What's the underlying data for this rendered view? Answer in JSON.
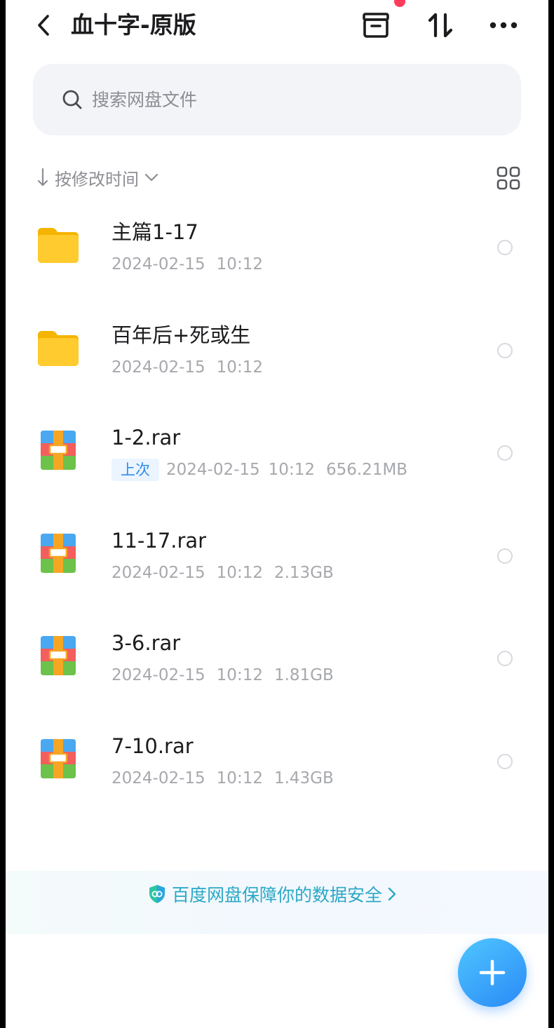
{
  "header": {
    "title": "血十字-原版",
    "icons": [
      "back-icon",
      "archive-icon",
      "transfer-icon",
      "more-icon"
    ]
  },
  "search": {
    "placeholder": "搜索网盘文件"
  },
  "sort": {
    "label": "按修改时间",
    "direction": "descending"
  },
  "files": [
    {
      "name": "主篇1-17",
      "type": "folder",
      "date": "2024-02-15",
      "time": "10:12",
      "size": "",
      "badge": ""
    },
    {
      "name": "百年后+死或生",
      "type": "folder",
      "date": "2024-02-15",
      "time": "10:12",
      "size": "",
      "badge": ""
    },
    {
      "name": "1-2.rar",
      "type": "archive",
      "date": "2024-02-15",
      "time": "10:12",
      "size": "656.21MB",
      "badge": "上次"
    },
    {
      "name": "11-17.rar",
      "type": "archive",
      "date": "2024-02-15",
      "time": "10:12",
      "size": "2.13GB",
      "badge": ""
    },
    {
      "name": "3-6.rar",
      "type": "archive",
      "date": "2024-02-15",
      "time": "10:12",
      "size": "1.81GB",
      "badge": ""
    },
    {
      "name": "7-10.rar",
      "type": "archive",
      "date": "2024-02-15",
      "time": "10:12",
      "size": "1.43GB",
      "badge": ""
    }
  ],
  "security_banner": {
    "text": "百度网盘保障你的数据安全"
  },
  "colors": {
    "accent": "#2a8af6",
    "folder": "#ffcb2e",
    "banner_text": "#2ba8c7",
    "badge_text": "#2c8cf0",
    "notification_dot": "#ff3b5c"
  }
}
